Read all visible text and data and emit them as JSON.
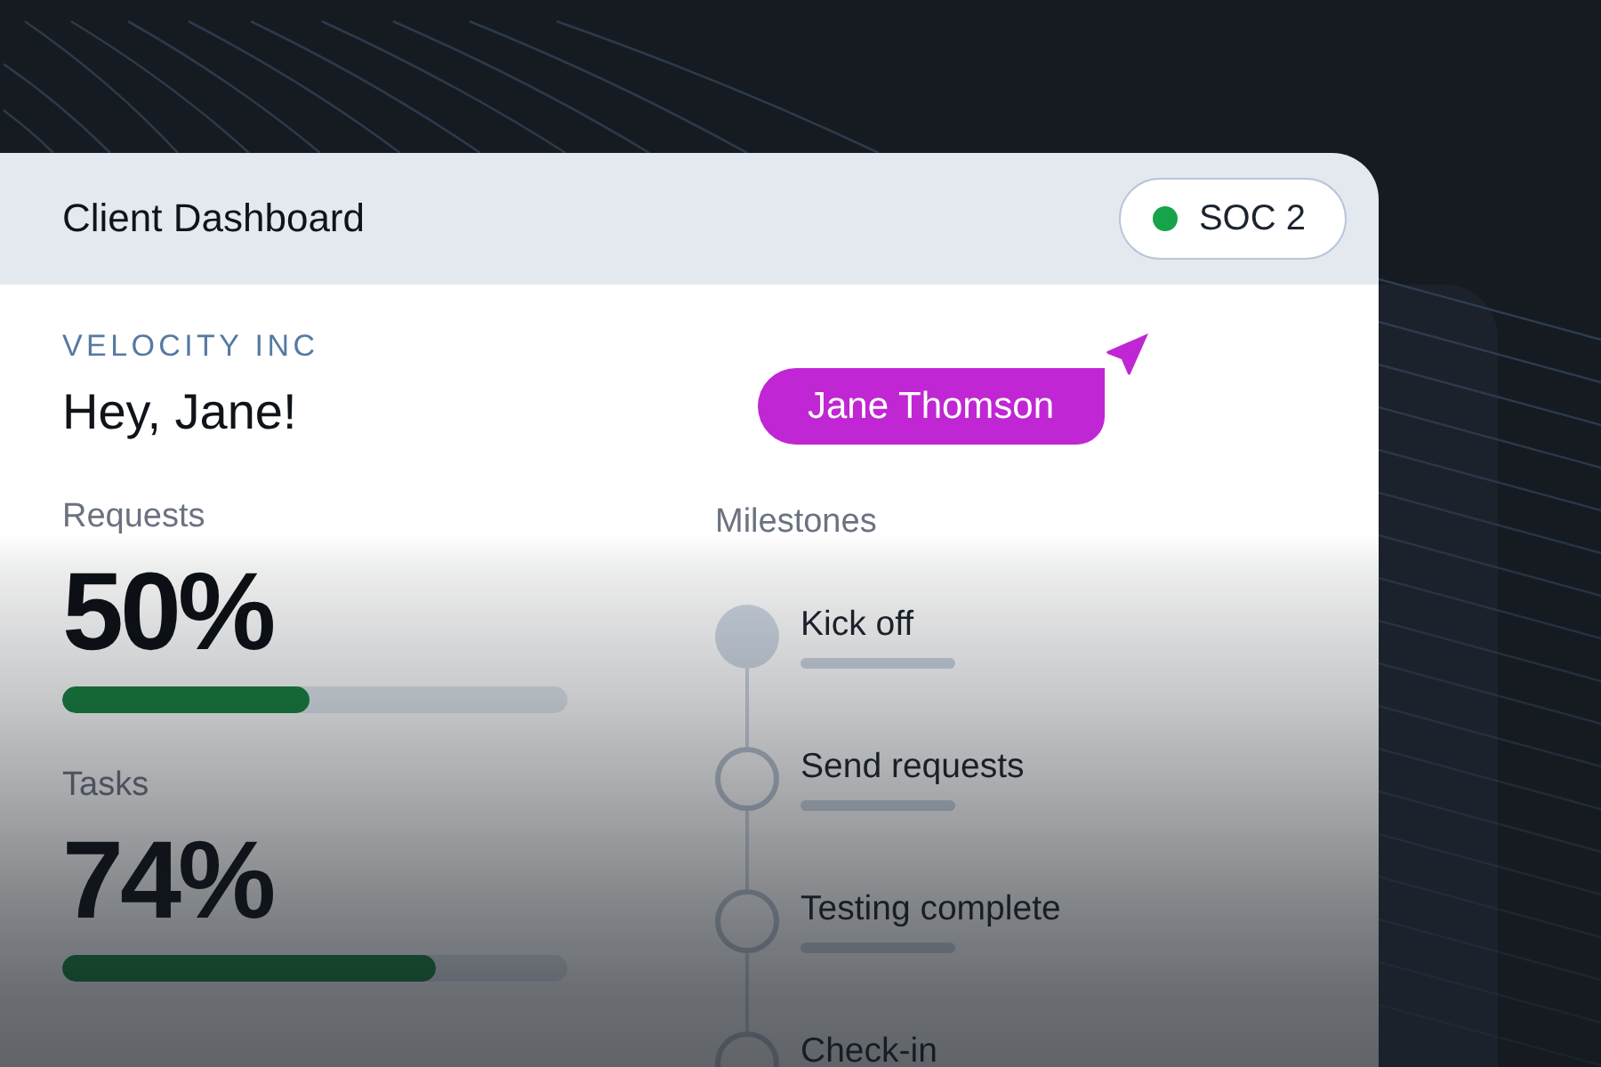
{
  "header": {
    "title": "Client Dashboard",
    "badge": "SOC 2"
  },
  "company": "VELOCITY INC",
  "greeting": "Hey, Jane!",
  "cursor": {
    "name": "Jane Thomson"
  },
  "metrics": [
    {
      "label": "Requests",
      "value": "50%",
      "level": 0.49
    },
    {
      "label": "Tasks",
      "value": "74%",
      "level": 0.74
    }
  ],
  "milestones": {
    "title": "Milestones",
    "items": [
      {
        "label": "Kick off",
        "completed": true
      },
      {
        "label": "Send requests",
        "completed": false
      },
      {
        "label": "Testing complete",
        "completed": false
      },
      {
        "label": "Check-in",
        "completed": false
      }
    ]
  }
}
